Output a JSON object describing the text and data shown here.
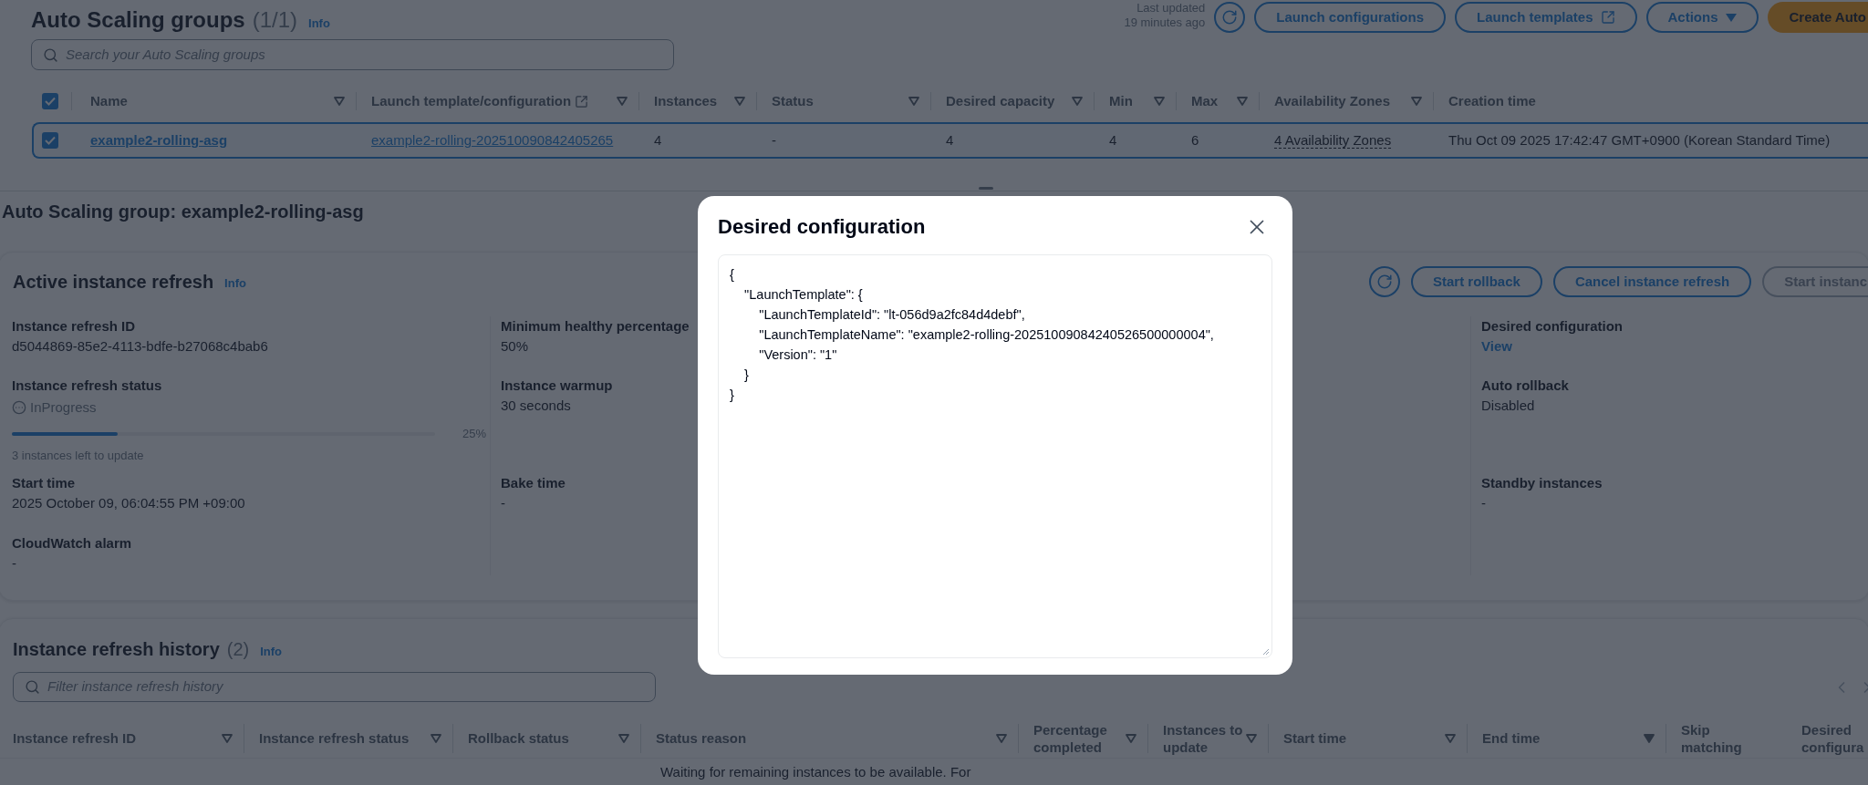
{
  "header": {
    "title": "Auto Scaling groups",
    "count": "(1/1)",
    "info": "Info",
    "updated_label": "Last updated",
    "updated_value": "19 minutes ago",
    "buttons": [
      {
        "label": "Launch configurations",
        "kind": "normal"
      },
      {
        "label": "Launch templates",
        "kind": "external"
      },
      {
        "label": "Actions",
        "kind": "dropdown"
      },
      {
        "label": "Create Auto",
        "kind": "primary"
      }
    ]
  },
  "search": {
    "placeholder": "Search your Auto Scaling groups"
  },
  "table": {
    "all_checked": true,
    "columns": [
      {
        "label": "Name",
        "filter": true,
        "external": false
      },
      {
        "label": "Launch template/configuration",
        "filter": true,
        "external": true
      },
      {
        "label": "Instances",
        "filter": true,
        "external": false
      },
      {
        "label": "Status",
        "filter": true,
        "external": false
      },
      {
        "label": "Desired capacity",
        "filter": true,
        "external": false
      },
      {
        "label": "Min",
        "filter": true,
        "external": false
      },
      {
        "label": "Max",
        "filter": true,
        "external": false
      },
      {
        "label": "Availability Zones",
        "filter": true,
        "external": false
      },
      {
        "label": "Creation time",
        "filter": false,
        "external": false
      }
    ],
    "rows": [
      {
        "checked": true,
        "selected": true,
        "cells": [
          {
            "text": "example2-rolling-asg",
            "kind": "bold-link"
          },
          {
            "text": "example2-rolling-202510090842405265",
            "kind": "link"
          },
          {
            "text": "4",
            "kind": "text"
          },
          {
            "text": "-",
            "kind": "text"
          },
          {
            "text": "4",
            "kind": "text"
          },
          {
            "text": "4",
            "kind": "text"
          },
          {
            "text": "6",
            "kind": "text"
          },
          {
            "text": "4 Availability Zones",
            "kind": "dotted"
          },
          {
            "text": "Thu Oct 09 2025 17:42:47 GMT+0900 (Korean Standard Time)",
            "kind": "text"
          }
        ]
      }
    ]
  },
  "detail_title": "Auto Scaling group: example2-rolling-asg",
  "active_refresh": {
    "title": "Active instance refresh",
    "info": "Info",
    "buttons": [
      {
        "label": "Start rollback",
        "disabled": false
      },
      {
        "label": "Cancel instance refresh",
        "disabled": false
      },
      {
        "label": "Start instanc",
        "disabled": true
      }
    ],
    "columns": [
      {
        "fields": [
          {
            "label": "Instance refresh ID",
            "kind": "text",
            "value": "d5044869-85e2-4113-bdfe-b27068c4bab6"
          },
          {
            "label": "Instance refresh status",
            "kind": "progress",
            "value": "InProgress",
            "level": 0.25,
            "reading": "25%",
            "note": "3 instances left to update"
          },
          {
            "label": "Start time",
            "kind": "text",
            "value": "2025 October 09, 06:04:55 PM +09:00"
          },
          {
            "label": "CloudWatch alarm",
            "kind": "text",
            "value": "-"
          }
        ]
      },
      {
        "fields": [
          {
            "label": "Minimum healthy percentage",
            "kind": "text",
            "value": "50%"
          },
          {
            "label": "Instance warmup",
            "kind": "text",
            "value": "30 seconds"
          },
          {
            "label": "Bake time",
            "kind": "text",
            "value": "-"
          }
        ]
      },
      {
        "fields": [
          {
            "label": "Desired configuration",
            "kind": "link",
            "value": "View"
          },
          {
            "label": "Auto rollback",
            "kind": "text",
            "value": "Disabled"
          },
          {
            "label": "Standby instances",
            "kind": "text",
            "value": "-"
          }
        ]
      }
    ]
  },
  "history": {
    "title": "Instance refresh history",
    "count": "(2)",
    "info": "Info",
    "filter": {
      "placeholder": "Filter instance refresh history"
    },
    "columns": [
      {
        "label": "Instance refresh ID",
        "sortable": true,
        "sorted": false
      },
      {
        "label": "Instance refresh status",
        "sortable": true,
        "sorted": false
      },
      {
        "label": "Rollback status",
        "sortable": true,
        "sorted": false
      },
      {
        "label": "Status reason",
        "sortable": true,
        "sorted": false
      },
      {
        "label": "Percentage completed",
        "sortable": true,
        "sorted": false
      },
      {
        "label": "Instances to update",
        "sortable": true,
        "sorted": false
      },
      {
        "label": "Start time",
        "sortable": true,
        "sorted": false
      },
      {
        "label": "End time",
        "sortable": true,
        "sorted": true
      },
      {
        "label": "Skip matching",
        "sortable": false
      },
      {
        "label": "Desired configura",
        "sortable": false
      }
    ],
    "row_partial": {
      "text": "Waiting for remaining instances to be available. For"
    }
  },
  "modal": {
    "title": "Desired configuration",
    "content": "{\n    \"LaunchTemplate\": {\n        \"LaunchTemplateId\": \"lt-056d9a2fc84d4debf\",\n        \"LaunchTemplateName\": \"example2-rolling-20251009084240526500000004\",\n        \"Version\": \"1\"\n    }\n}"
  }
}
